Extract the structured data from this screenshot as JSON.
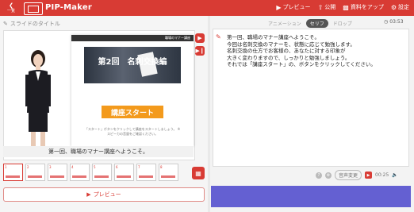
{
  "topbar": {
    "back_icon": "chevron-left-icon",
    "back_label": "一覧",
    "app_title": "PIP-Maker",
    "actions": [
      {
        "icon": "play-icon",
        "label": "プレビュー"
      },
      {
        "icon": "share-icon",
        "label": "公開"
      },
      {
        "icon": "upload-icon",
        "label": "資料をアップ"
      },
      {
        "icon": "gear-icon",
        "label": "設定"
      }
    ]
  },
  "slide_title_placeholder": "スライドのタイトル",
  "slide": {
    "top_label": "職場のマナー講座",
    "heading": "第2回　名刺交換編",
    "start_button": "講座スタート",
    "note": "「スタート」ボタンをクリックして講座をスタートしましょう。 ※スピーカの音量をご確認ください。"
  },
  "caption": "第一回、職場のマナー講座へようこそ。",
  "right": {
    "tabs": [
      "アニメーション",
      "セリフ",
      "ドロップ"
    ],
    "active_tab": "セリフ",
    "timer": "03:53",
    "script_lines": [
      "第一回、職場のマナー講座へようこそ。",
      "今回は名刺交換のマナーを、状態に応じて勉強します。",
      "名刺交換の仕方でお客様の、あなたに対する印象が",
      "大きく変わりますので、しっかりと勉強しましょう。",
      "それでは「講座スタート」の、ボタンをクリックしてください。"
    ],
    "voice_change": "音声変更",
    "duration": "00:25"
  },
  "preview_label": "プレビュー",
  "thumbnails": [
    1,
    2,
    3,
    4,
    5,
    6,
    7,
    8
  ],
  "colors": {
    "accent": "#d83b34",
    "bottom_bar": "#6460d2"
  }
}
